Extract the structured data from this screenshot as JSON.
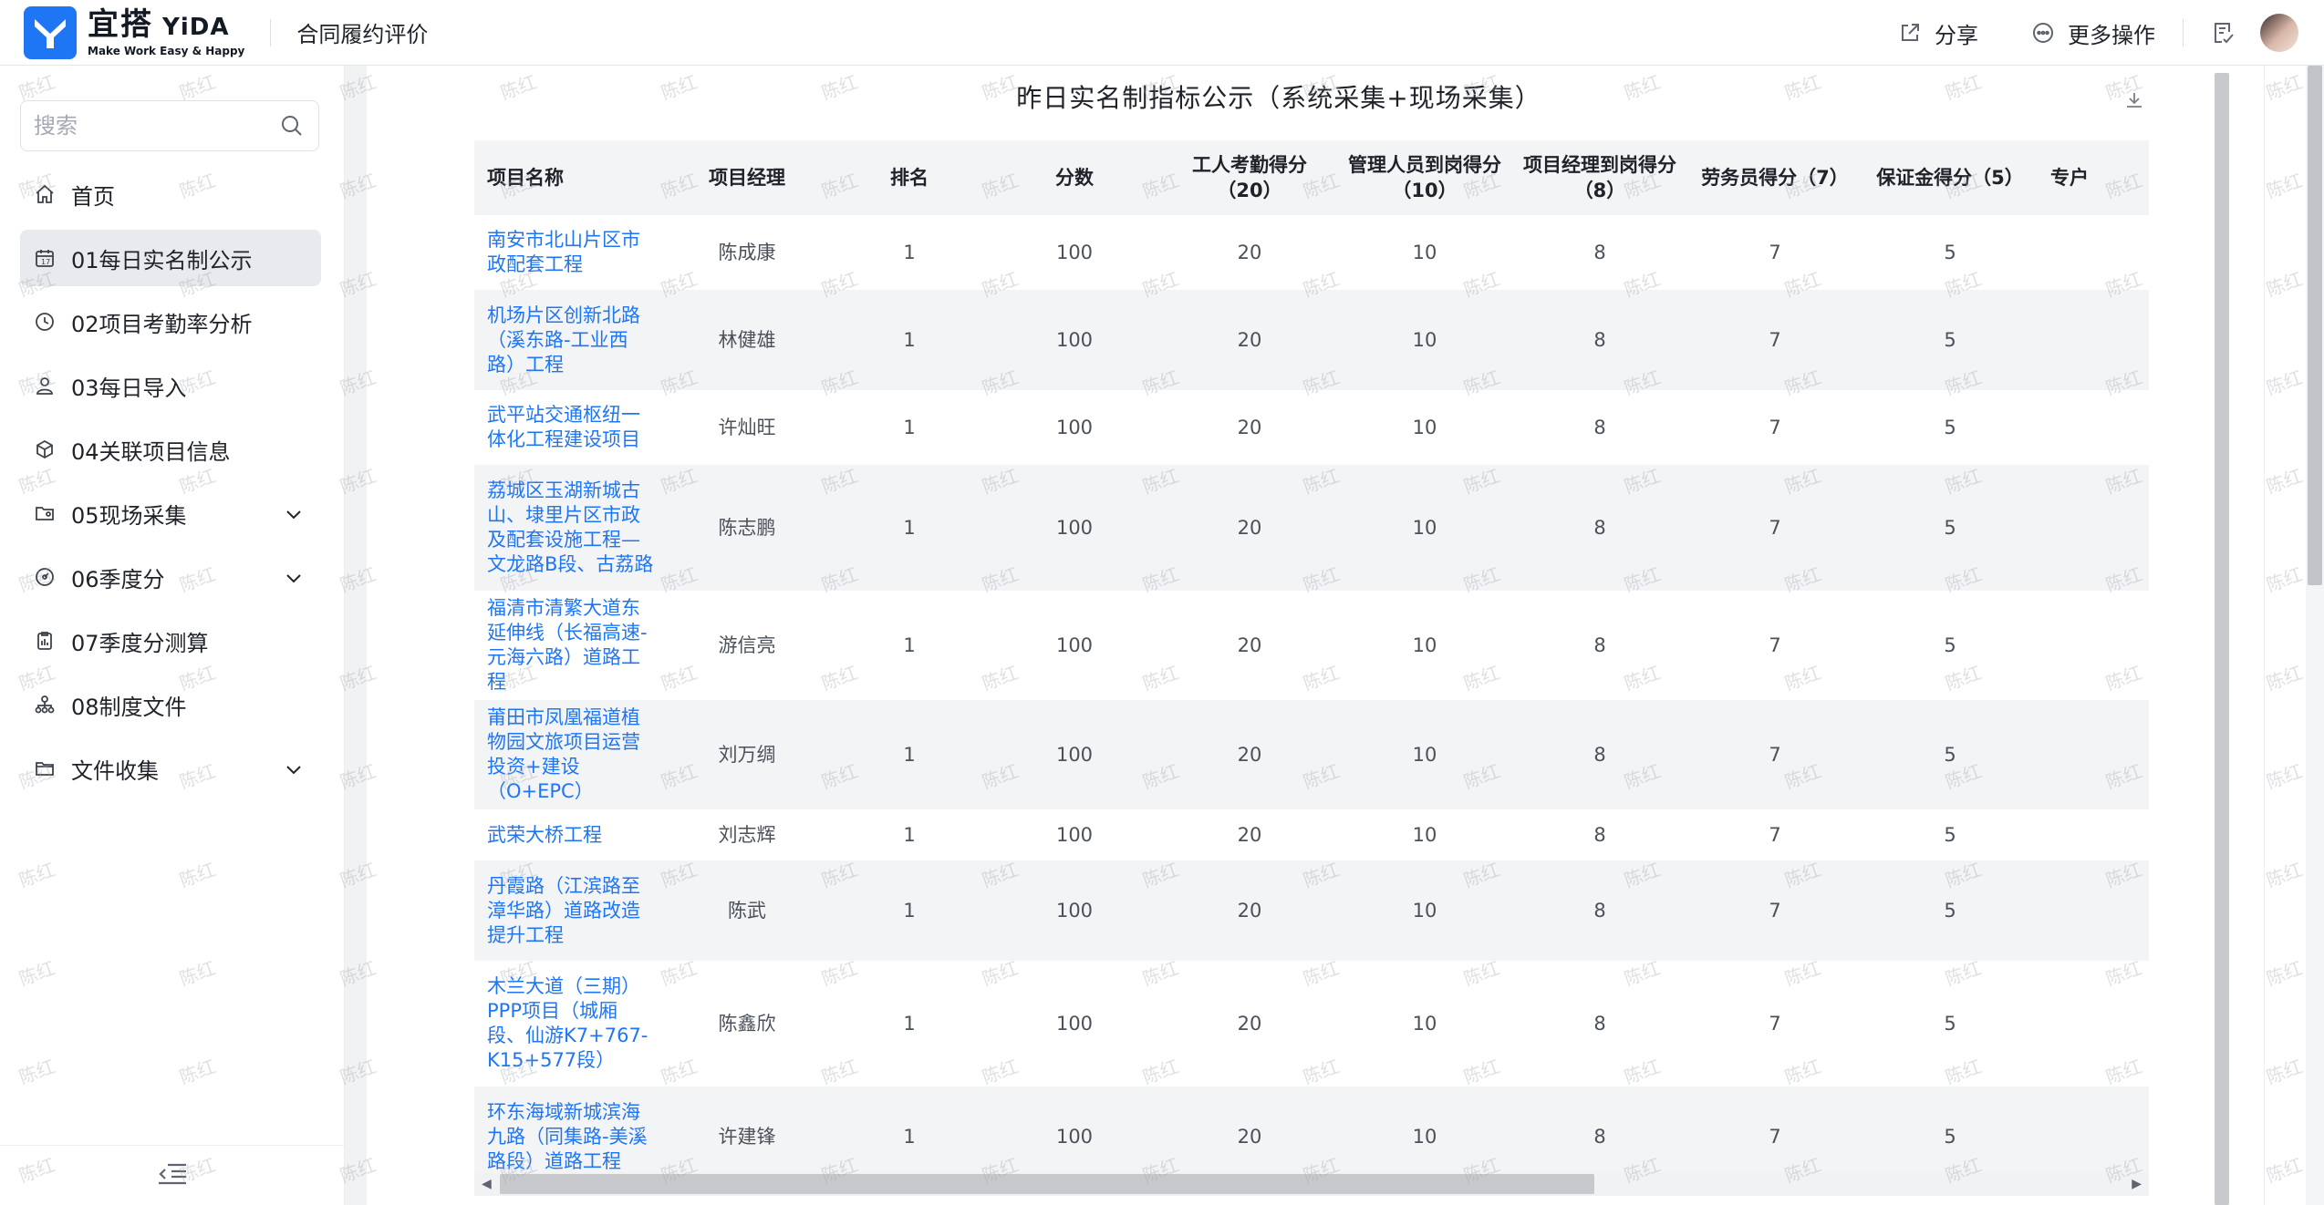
{
  "app": {
    "logo_cn": "宜搭",
    "logo_en": "YiDA",
    "logo_tagline": "Make Work Easy & Happy",
    "title": "合同履约评价"
  },
  "top_actions": {
    "share": "分享",
    "more": "更多操作"
  },
  "sidebar": {
    "search_placeholder": "搜索",
    "items": [
      {
        "label": "首页",
        "icon": "home-icon"
      },
      {
        "label": "01每日实名制公示",
        "icon": "calendar-icon",
        "active": true
      },
      {
        "label": "02项目考勤率分析",
        "icon": "clock-icon"
      },
      {
        "label": "03每日导入",
        "icon": "user-icon"
      },
      {
        "label": "04关联项目信息",
        "icon": "cube-icon"
      },
      {
        "label": "05现场采集",
        "icon": "folder-user-icon",
        "expandable": true
      },
      {
        "label": "06季度分",
        "icon": "gauge-icon",
        "expandable": true
      },
      {
        "label": "07季度分测算",
        "icon": "clipboard-icon"
      },
      {
        "label": "08制度文件",
        "icon": "org-chart-icon"
      },
      {
        "label": "文件收集",
        "icon": "folder-icon",
        "expandable": true
      }
    ]
  },
  "page": {
    "title": "昨日实名制指标公示（系统采集+现场采集）"
  },
  "table": {
    "columns": [
      "项目名称",
      "项目经理",
      "排名",
      "分数",
      "工人考勤得分（20）",
      "管理人员到岗得分（10）",
      "项目经理到岗得分（8）",
      "劳务员得分（7）",
      "保证金得分（5）",
      "专户"
    ],
    "rows": [
      {
        "name": "南安市北山片区市政配套工程",
        "manager": "陈成康",
        "rank": "1",
        "score": "100",
        "worker": "20",
        "mgmt": "10",
        "pm": "8",
        "labor": "7",
        "deposit": "5"
      },
      {
        "name": "机场片区创新北路（溪东路-工业西路）工程",
        "manager": "林健雄",
        "rank": "1",
        "score": "100",
        "worker": "20",
        "mgmt": "10",
        "pm": "8",
        "labor": "7",
        "deposit": "5"
      },
      {
        "name": "武平站交通枢纽一体化工程建设项目",
        "manager": "许灿旺",
        "rank": "1",
        "score": "100",
        "worker": "20",
        "mgmt": "10",
        "pm": "8",
        "labor": "7",
        "deposit": "5"
      },
      {
        "name": "荔城区玉湖新城古山、埭里片区市政及配套设施工程—文龙路B段、古荔路",
        "manager": "陈志鹏",
        "rank": "1",
        "score": "100",
        "worker": "20",
        "mgmt": "10",
        "pm": "8",
        "labor": "7",
        "deposit": "5"
      },
      {
        "name": "福清市清繁大道东延伸线（长福高速-元海六路）道路工程",
        "manager": "游信亮",
        "rank": "1",
        "score": "100",
        "worker": "20",
        "mgmt": "10",
        "pm": "8",
        "labor": "7",
        "deposit": "5"
      },
      {
        "name": "莆田市凤凰福道植物园文旅项目运营投资+建设（O+EPC）",
        "manager": "刘万绸",
        "rank": "1",
        "score": "100",
        "worker": "20",
        "mgmt": "10",
        "pm": "8",
        "labor": "7",
        "deposit": "5"
      },
      {
        "name": "武荣大桥工程",
        "manager": "刘志辉",
        "rank": "1",
        "score": "100",
        "worker": "20",
        "mgmt": "10",
        "pm": "8",
        "labor": "7",
        "deposit": "5"
      },
      {
        "name": "丹霞路（江滨路至漳华路）道路改造提升工程",
        "manager": "陈武",
        "rank": "1",
        "score": "100",
        "worker": "20",
        "mgmt": "10",
        "pm": "8",
        "labor": "7",
        "deposit": "5"
      },
      {
        "name": "木兰大道（三期）PPP项目（城厢段、仙游K7+767-K15+577段）",
        "manager": "陈鑫欣",
        "rank": "1",
        "score": "100",
        "worker": "20",
        "mgmt": "10",
        "pm": "8",
        "labor": "7",
        "deposit": "5"
      },
      {
        "name": "环东海域新城滨海九路（同集路-美溪路段）道路工程",
        "manager": "许建锋",
        "rank": "1",
        "score": "100",
        "worker": "20",
        "mgmt": "10",
        "pm": "8",
        "labor": "7",
        "deposit": "5"
      }
    ]
  },
  "watermark": "陈红",
  "colors": {
    "brand": "#1f76f5",
    "link": "#1f76f5",
    "active_nav_bg": "#e8eaed"
  }
}
